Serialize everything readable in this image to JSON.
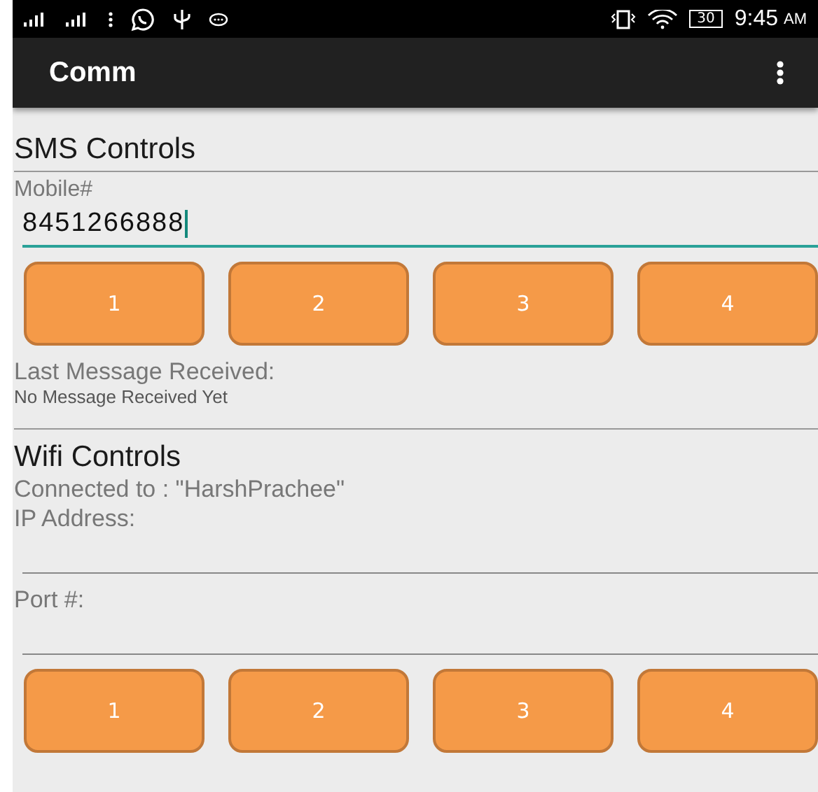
{
  "status_bar": {
    "battery": "30",
    "time": "9:45",
    "ampm": "AM"
  },
  "app_bar": {
    "title": "Comm"
  },
  "sms": {
    "title": "SMS Controls",
    "mobile_label": "Mobile#",
    "mobile_value": "8451266888",
    "buttons": [
      "1",
      "2",
      "3",
      "4"
    ],
    "last_label": "Last Message Received:",
    "last_value": "No Message Received Yet"
  },
  "wifi": {
    "title": "Wifi Controls",
    "connected": "Connected to : \"HarshPrachee\"",
    "ip_label": "IP Address:",
    "port_label": "Port #:",
    "buttons": [
      "1",
      "2",
      "3",
      "4"
    ]
  }
}
